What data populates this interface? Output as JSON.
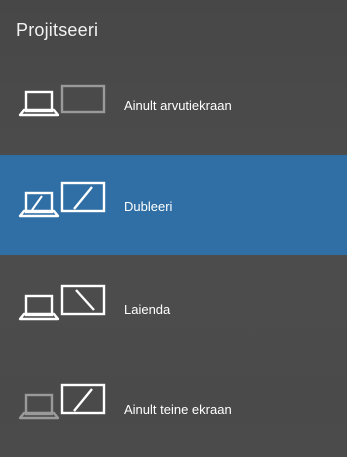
{
  "panel": {
    "title": "Projitseeri"
  },
  "options": [
    {
      "label": "Ainult arvutiekraan",
      "icon": "pc-screen-only-icon",
      "selected": false
    },
    {
      "label": "Dubleeri",
      "icon": "duplicate-icon",
      "selected": true
    },
    {
      "label": "Laienda",
      "icon": "extend-icon",
      "selected": false
    },
    {
      "label": "Ainult teine ekraan",
      "icon": "second-screen-only-icon",
      "selected": false
    }
  ],
  "colors": {
    "background": "#4b4b4b",
    "selected": "#2f6fa5",
    "icon_active": "#ffffff",
    "icon_dim": "#9a9a9a"
  }
}
